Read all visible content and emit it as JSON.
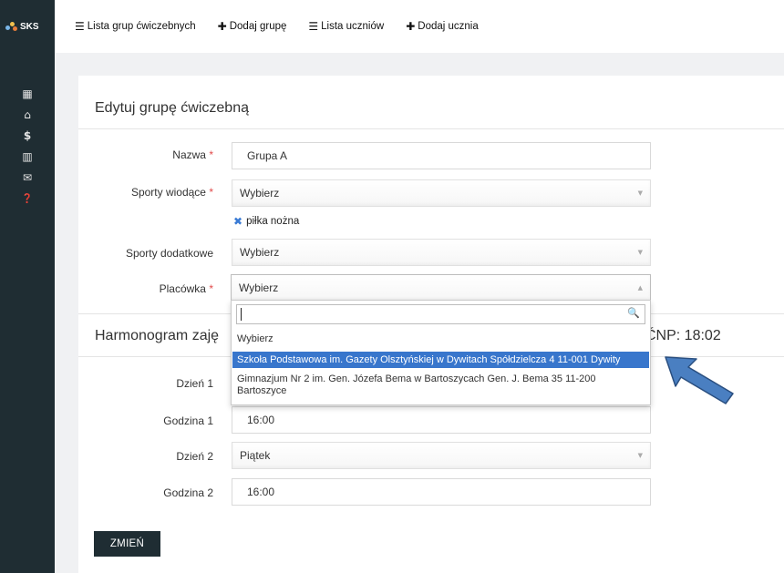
{
  "app": {
    "logo_text": "SKS"
  },
  "topnav": [
    {
      "icon": "list-icon",
      "glyph": "☰",
      "label": "Lista grup ćwiczebnych"
    },
    {
      "icon": "plus-icon",
      "glyph": "✚",
      "label": "Dodaj grupę"
    },
    {
      "icon": "list-icon",
      "glyph": "☰",
      "label": "Lista uczniów"
    },
    {
      "icon": "plus-icon",
      "glyph": "✚",
      "label": "Dodaj ucznia"
    }
  ],
  "sidebar": {
    "icons": [
      {
        "name": "calendar-icon",
        "glyph": "▦"
      },
      {
        "name": "home-icon",
        "glyph": "⌂"
      },
      {
        "name": "dollar-icon",
        "glyph": "$"
      },
      {
        "name": "book-icon",
        "glyph": "▥"
      },
      {
        "name": "envelope-icon",
        "glyph": "✉"
      },
      {
        "name": "question-icon",
        "glyph": "❓"
      }
    ]
  },
  "form": {
    "title": "Edytuj grupę ćwiczebną",
    "required_mark": "*",
    "name_label": "Nazwa",
    "name_value": "Grupa A",
    "main_sports_label": "Sporty wiodące",
    "main_sports_value": "Wybierz",
    "selected_tag_x": "✖",
    "selected_tag": "piłka nożna",
    "extra_sports_label": "Sporty dodatkowe",
    "extra_sports_value": "Wybierz",
    "facility_label": "Placówka",
    "facility_value": "Wybierz",
    "arrow_down": "▼",
    "arrow_up": "▲"
  },
  "schedule": {
    "title_visible": "Harmonogram zaję",
    "right_visible": "ĆNP: 18:02",
    "day1_label": "Dzień 1",
    "hour1_label": "Godzina 1",
    "hour1_value": "16:00",
    "day2_label": "Dzień 2",
    "day2_value": "Piątek",
    "hour2_label": "Godzina 2",
    "hour2_value": "16:00"
  },
  "dropdown": {
    "search_value": "",
    "search_icon": "🔍",
    "options": [
      "Wybierz",
      "Szkoła Podstawowa im. Gazety Olsztyńskiej w Dywitach Spółdzielcza 4 11-001 Dywity",
      "Gimnazjum Nr 2 im. Gen. Józefa Bema w Bartoszycach Gen. J. Bema 35 11-200",
      "Bartoszyce"
    ]
  },
  "submit_label": "ZMIEŃ",
  "colors": {
    "sidebar": "#1f2d33",
    "highlight": "#3876cc",
    "required": "#e14a4a",
    "pointer_arrow": "#4a7fc1"
  }
}
